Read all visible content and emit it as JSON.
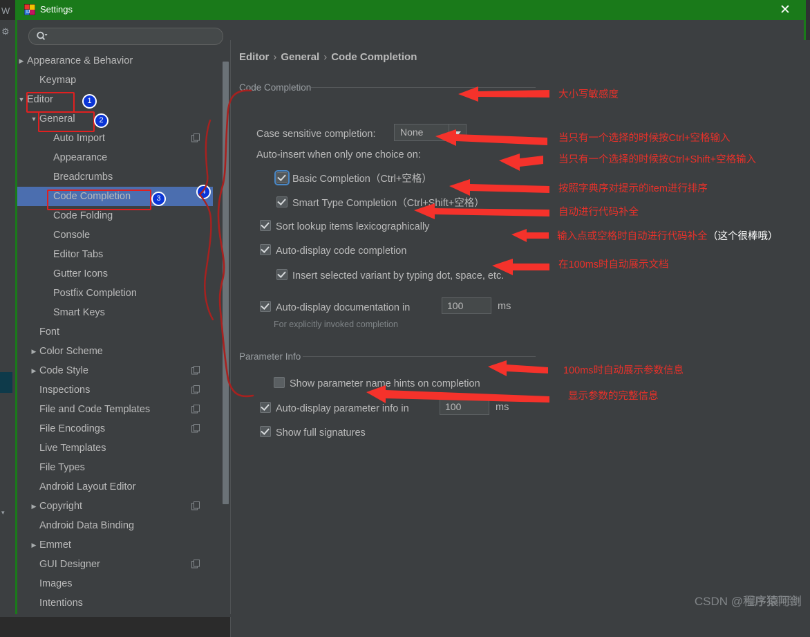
{
  "window": {
    "title": "Settings",
    "close_label": "✕",
    "logo_name": "intellij-idea-logo"
  },
  "search": {
    "value": "",
    "placeholder": ""
  },
  "sidebar": {
    "items": [
      {
        "label": "Appearance & Behavior",
        "indent": 1,
        "arrow": "▶",
        "copy": false,
        "selected": false
      },
      {
        "label": "Keymap",
        "indent": 2,
        "arrow": "",
        "copy": false,
        "selected": false
      },
      {
        "label": "Editor",
        "indent": 1,
        "arrow": "▼",
        "copy": false,
        "selected": false
      },
      {
        "label": "General",
        "indent": 2,
        "arrow": "▼",
        "copy": false,
        "selected": false
      },
      {
        "label": "Auto Import",
        "indent": 3,
        "arrow": "",
        "copy": true,
        "selected": false
      },
      {
        "label": "Appearance",
        "indent": 3,
        "arrow": "",
        "copy": false,
        "selected": false
      },
      {
        "label": "Breadcrumbs",
        "indent": 3,
        "arrow": "",
        "copy": false,
        "selected": false
      },
      {
        "label": "Code Completion",
        "indent": 3,
        "arrow": "",
        "copy": false,
        "selected": true
      },
      {
        "label": "Code Folding",
        "indent": 3,
        "arrow": "",
        "copy": false,
        "selected": false
      },
      {
        "label": "Console",
        "indent": 3,
        "arrow": "",
        "copy": false,
        "selected": false
      },
      {
        "label": "Editor Tabs",
        "indent": 3,
        "arrow": "",
        "copy": false,
        "selected": false
      },
      {
        "label": "Gutter Icons",
        "indent": 3,
        "arrow": "",
        "copy": false,
        "selected": false
      },
      {
        "label": "Postfix Completion",
        "indent": 3,
        "arrow": "",
        "copy": false,
        "selected": false
      },
      {
        "label": "Smart Keys",
        "indent": 3,
        "arrow": "",
        "copy": false,
        "selected": false
      },
      {
        "label": "Font",
        "indent": 2,
        "arrow": "",
        "copy": false,
        "selected": false
      },
      {
        "label": "Color Scheme",
        "indent": 2,
        "arrow": "▶",
        "copy": false,
        "selected": false
      },
      {
        "label": "Code Style",
        "indent": 2,
        "arrow": "▶",
        "copy": true,
        "selected": false
      },
      {
        "label": "Inspections",
        "indent": 2,
        "arrow": "",
        "copy": true,
        "selected": false
      },
      {
        "label": "File and Code Templates",
        "indent": 2,
        "arrow": "",
        "copy": true,
        "selected": false
      },
      {
        "label": "File Encodings",
        "indent": 2,
        "arrow": "",
        "copy": true,
        "selected": false
      },
      {
        "label": "Live Templates",
        "indent": 2,
        "arrow": "",
        "copy": false,
        "selected": false
      },
      {
        "label": "File Types",
        "indent": 2,
        "arrow": "",
        "copy": false,
        "selected": false
      },
      {
        "label": "Android Layout Editor",
        "indent": 2,
        "arrow": "",
        "copy": false,
        "selected": false
      },
      {
        "label": "Copyright",
        "indent": 2,
        "arrow": "▶",
        "copy": true,
        "selected": false
      },
      {
        "label": "Android Data Binding",
        "indent": 2,
        "arrow": "",
        "copy": false,
        "selected": false
      },
      {
        "label": "Emmet",
        "indent": 2,
        "arrow": "▶",
        "copy": false,
        "selected": false
      },
      {
        "label": "GUI Designer",
        "indent": 2,
        "arrow": "",
        "copy": true,
        "selected": false
      },
      {
        "label": "Images",
        "indent": 2,
        "arrow": "",
        "copy": false,
        "selected": false
      },
      {
        "label": "Intentions",
        "indent": 2,
        "arrow": "",
        "copy": false,
        "selected": false
      }
    ]
  },
  "breadcrumb": {
    "part1": "Editor",
    "part2": "General",
    "part3": "Code Completion",
    "sep": "›"
  },
  "main": {
    "group_code_completion": "Code Completion",
    "case_sensitive_label": "Case sensitive completion:",
    "case_sensitive_value": "None",
    "auto_insert_label": "Auto-insert when only one choice on:",
    "basic_completion": "Basic Completion（Ctrl+空格）",
    "smart_type_completion": "Smart Type Completion（Ctrl+Shift+空格）",
    "sort_lookup": "Sort lookup items lexicographically",
    "auto_display_code": "Auto-display code completion",
    "insert_selected_variant": "Insert selected variant by typing dot, space, etc.",
    "auto_display_doc": "Auto-display documentation in",
    "auto_display_doc_value": "100",
    "ms": "ms",
    "explicit_hint": "For explicitly invoked completion",
    "group_parameter_info": "Parameter Info",
    "show_param_hints": "Show parameter name hints on completion",
    "auto_display_param": "Auto-display parameter info in",
    "auto_display_param_value": "100",
    "show_full_signatures": "Show full signatures"
  },
  "annotations": {
    "a1": "大小写敏感度",
    "a2": "当只有一个选择的时候按Ctrl+空格输入",
    "a3": "当只有一个选择的时候按Ctrl+Shift+空格输入",
    "a4": "按照字典序对提示的item进行排序",
    "a5": "自动进行代码补全",
    "a6_red": "输入点或空格时自动进行代码补全",
    "a6_white": "（这个很棒哦）",
    "a7": "在100ms时自动展示文档",
    "a8": "100ms时自动展示参数信息",
    "a9": "显示参数的完整信息",
    "badges": [
      "1",
      "2",
      "3",
      "4"
    ]
  },
  "watermark": {
    "text": "CSDN @程序猿阿剑",
    "ghost": "程序猿阿剑!"
  }
}
